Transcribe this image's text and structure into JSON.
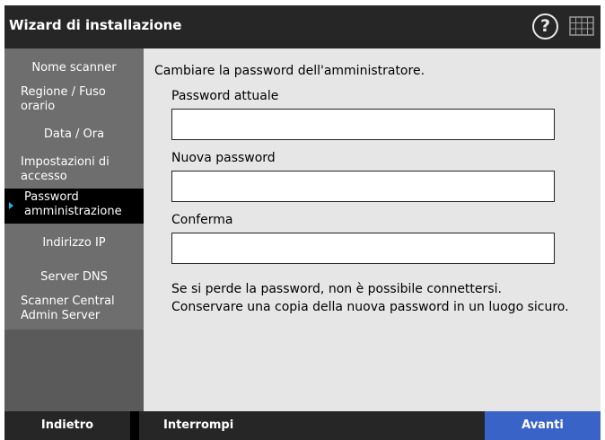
{
  "window": {
    "title": "Wizard di installazione",
    "help_glyph": "?",
    "icons": [
      "help-icon",
      "keyboard-icon"
    ]
  },
  "sidebar": {
    "items": [
      {
        "label": "Nome scanner",
        "active": false
      },
      {
        "label": "Regione / Fuso orario",
        "active": false
      },
      {
        "label": "Data / Ora",
        "active": false
      },
      {
        "label": "Impostazioni di accesso",
        "active": false
      },
      {
        "label": "Password amministrazione",
        "active": true
      },
      {
        "label": "Indirizzo IP",
        "active": false
      },
      {
        "label": "Server DNS",
        "active": false
      },
      {
        "label": "Scanner Central Admin Server",
        "active": false
      }
    ]
  },
  "main": {
    "instruction": "Cambiare la password dell'amministratore.",
    "fields": [
      {
        "label": "Password attuale",
        "value": "",
        "placeholder": ""
      },
      {
        "label": "Nuova password",
        "value": "",
        "placeholder": ""
      },
      {
        "label": "Conferma",
        "value": "",
        "placeholder": ""
      }
    ],
    "note_line1": "Se si perde la password, non è possibile connettersi.",
    "note_line2": "Conservare una copia della nuova password in un luogo sicuro."
  },
  "footer": {
    "back_label": "Indietro",
    "stop_label": "Interrompi",
    "next_label": "Avanti"
  },
  "colors": {
    "titlebar": "#262626",
    "sidebar": "#6e6e6e",
    "active_item": "#000000",
    "active_marker": "#19b3e6",
    "content_bg": "#e6e6e6",
    "next_button": "#3a63c8"
  }
}
